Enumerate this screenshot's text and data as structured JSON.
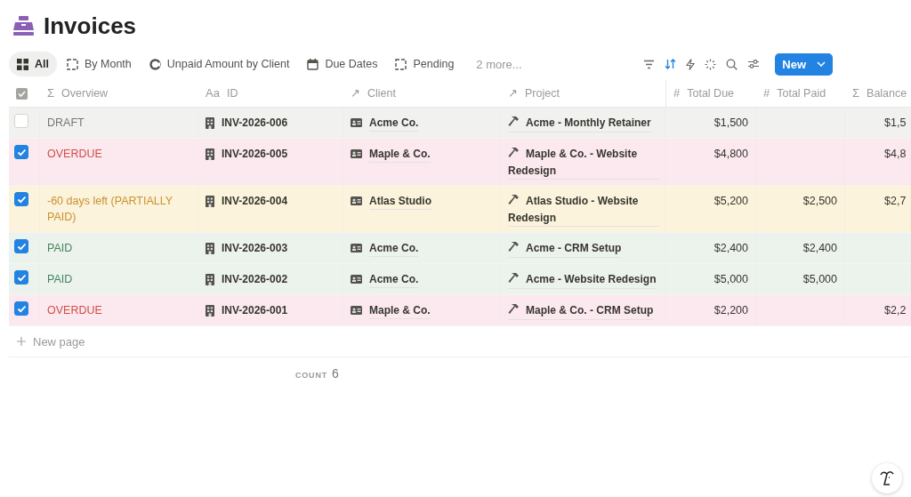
{
  "page": {
    "title": "Invoices"
  },
  "tabs": [
    {
      "label": "All",
      "selected": true
    },
    {
      "label": "By Month",
      "selected": false
    },
    {
      "label": "Unpaid Amount by Client",
      "selected": false
    },
    {
      "label": "Due Dates",
      "selected": false
    },
    {
      "label": "Pending",
      "selected": false
    }
  ],
  "more_views": "2 more...",
  "new_button": "New",
  "table": {
    "select_all_checked": true,
    "columns": [
      {
        "icon": "Σ",
        "label": "Overview"
      },
      {
        "icon": "Aa",
        "label": "ID"
      },
      {
        "icon": "↗",
        "label": "Client"
      },
      {
        "icon": "↗",
        "label": "Project"
      },
      {
        "icon": "#",
        "label": "Total Due"
      },
      {
        "icon": "#",
        "label": "Total Paid"
      },
      {
        "icon": "Σ",
        "label": "Balance"
      }
    ],
    "rows": [
      {
        "checked": false,
        "kind": "draft",
        "overview": "DRAFT",
        "id": "INV-2026-006",
        "client": "Acme Co.",
        "project": "Acme - Monthly Retainer",
        "total_due": "$1,500",
        "balance": "$1,5"
      },
      {
        "checked": true,
        "kind": "overdue",
        "overview": "OVERDUE",
        "id": "INV-2026-005",
        "client": "Maple & Co.",
        "project": "Maple & Co. - Website Redesign",
        "total_due": "$4,800",
        "balance": "$4,8"
      },
      {
        "checked": true,
        "kind": "partial",
        "overview": "-60 days left (PARTIALLY PAID)",
        "id": "INV-2026-004",
        "client": "Atlas Studio",
        "project": "Atlas Studio - Website Redesign",
        "total_due": "$5,200",
        "total_paid": "$2,500",
        "balance": "$2,7"
      },
      {
        "checked": true,
        "kind": "paid",
        "overview": "PAID",
        "id": "INV-2026-003",
        "client": "Acme Co.",
        "project": "Acme - CRM Setup",
        "total_due": "$2,400",
        "total_paid": "$2,400"
      },
      {
        "checked": true,
        "kind": "paid",
        "overview": "PAID",
        "id": "INV-2026-002",
        "client": "Acme Co.",
        "project": "Acme - Website Redesign",
        "total_due": "$5,000",
        "total_paid": "$5,000"
      },
      {
        "checked": true,
        "kind": "overdue",
        "overview": "OVERDUE",
        "id": "INV-2026-001",
        "client": "Maple & Co.",
        "project": "Maple & Co. - CRM Setup",
        "total_due": "$2,200",
        "balance": "$2,2"
      }
    ],
    "new_row": "New page",
    "count_label": "COUNT",
    "count_value": "6"
  }
}
